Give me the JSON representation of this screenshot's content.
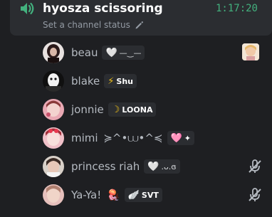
{
  "channel": {
    "name": "hyosza scissoring",
    "timer": "1:17:20",
    "status_placeholder": "Set a channel status"
  },
  "users": [
    {
      "name": "beau",
      "tag_glyph": "🤍",
      "tag_text": "—‿—",
      "right_icon": "activity-thumbnail"
    },
    {
      "name": "blake",
      "tag_glyph": "⚡",
      "tag_text": "Shu",
      "right_icon": ""
    },
    {
      "name": "jonnie",
      "tag_glyph": "☽",
      "tag_text": "LOONA",
      "right_icon": ""
    },
    {
      "name": "mimi",
      "name_suffix": "≽^•⩊•^≼",
      "tag_glyph": "🩷",
      "tag_text": "✦",
      "right_icon": ""
    },
    {
      "name": "princess riah",
      "tag_glyph": "🤍",
      "tag_text": ".ᴗ.ɞ",
      "right_icon": "muted-mic-icon"
    },
    {
      "name": "Ya-Ya!",
      "name_suffix": "🪼",
      "tag_glyph": "🪽",
      "tag_text": "SVT",
      "right_icon": "muted-mic-icon"
    }
  ],
  "colors": {
    "background": "#1e1f22",
    "header_bg": "#2b2d31",
    "timer": "#43b17e",
    "speaker": "#43b17e",
    "username": "#b5bac1",
    "muted_icon": "#b5bac1"
  }
}
